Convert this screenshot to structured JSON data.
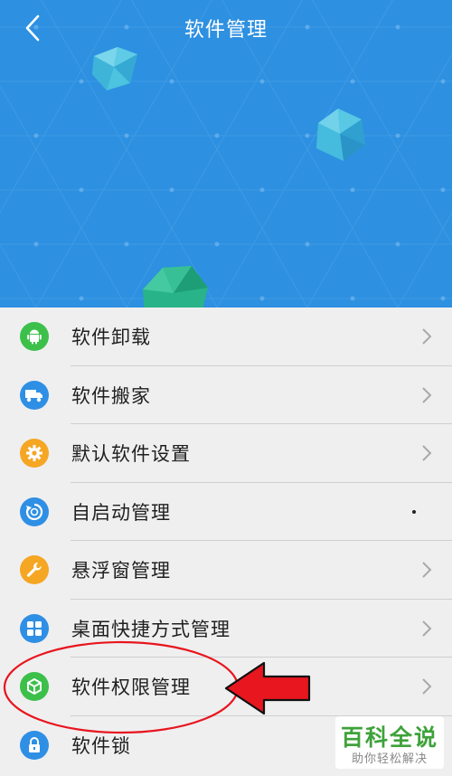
{
  "header": {
    "title": "软件管理",
    "back_icon": "chevron-left-icon"
  },
  "colors": {
    "hero_bg": "#2d90e1",
    "list_bg": "#efeff0",
    "annotation": "#e8161e",
    "watermark_green": "#3ea23a"
  },
  "menu": {
    "items": [
      {
        "label": "软件卸载",
        "icon": "android-icon",
        "icon_color": "#3cc04a"
      },
      {
        "label": "软件搬家",
        "icon": "truck-icon",
        "icon_color": "#2f8fe4"
      },
      {
        "label": "默认软件设置",
        "icon": "gear-icon",
        "icon_color": "#f5a623"
      },
      {
        "label": "自启动管理",
        "icon": "power-cycle-icon",
        "icon_color": "#2f8fe4"
      },
      {
        "label": "悬浮窗管理",
        "icon": "wrench-icon",
        "icon_color": "#f5a623"
      },
      {
        "label": "桌面快捷方式管理",
        "icon": "grid-icon",
        "icon_color": "#2f8fe4"
      },
      {
        "label": "软件权限管理",
        "icon": "cube-icon",
        "icon_color": "#3cc04a"
      },
      {
        "label": "软件锁",
        "icon": "lock-icon",
        "icon_color": "#2f8fe4"
      }
    ]
  },
  "watermark": {
    "main": "百科全说",
    "sub": "助你轻松解决"
  }
}
